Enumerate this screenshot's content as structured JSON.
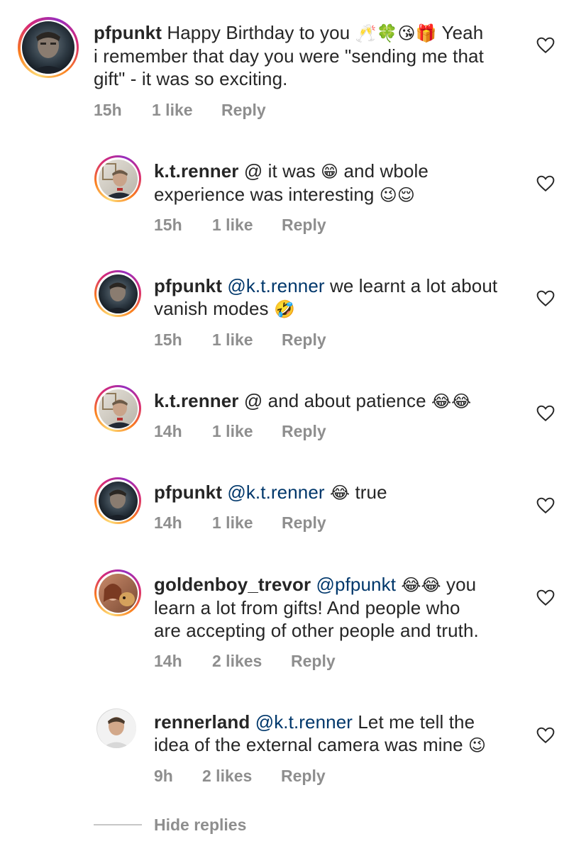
{
  "comments": [
    {
      "username": "pfpunkt",
      "mention": "",
      "text_before": "Happy Birthday to you",
      "emoji_a": "🥂🍀😘🎁",
      "text_after_line1": " Yeah",
      "line2": "i remember that day you were \"sending me that",
      "line3": "gift\" - it was so exciting.",
      "time": "15h",
      "likes": "1 like",
      "reply": "Reply"
    },
    {
      "username": "k.t.renner",
      "mention": "@",
      "line1_text": " it was ",
      "emoji_a": "😁",
      "line1_after": " and wbole",
      "line2": "experience was interesting ",
      "emoji_b": "😉😌",
      "time": "15h",
      "likes": "1 like",
      "reply": "Reply"
    },
    {
      "username": "pfpunkt",
      "mention": "@k.t.renner",
      "line1_text": " we learnt a lot about",
      "line2": "vanish modes ",
      "emoji_b": "🤣",
      "time": "15h",
      "likes": "1 like",
      "reply": "Reply"
    },
    {
      "username": "k.t.renner",
      "mention": "@",
      "line1_text": " and about patience ",
      "emoji_a": "😂😂",
      "time": "14h",
      "likes": "1 like",
      "reply": "Reply"
    },
    {
      "username": "pfpunkt",
      "mention": "@k.t.renner",
      "emoji_a": "😂",
      "line1_after": " true",
      "time": "14h",
      "likes": "1 like",
      "reply": "Reply"
    },
    {
      "username": "goldenboy_trevor",
      "mention": "@pfpunkt",
      "emoji_a": "😂😂",
      "line1_after": " you",
      "line2": "learn a lot from gifts! And people who",
      "line3": "are accepting of other people and truth.",
      "time": "14h",
      "likes": "2 likes",
      "reply": "Reply"
    },
    {
      "username": "rennerland",
      "mention": "@k.t.renner",
      "line1_text": " Let me tell the",
      "line2": "idea of the external camera was mine ",
      "emoji_b": "😉",
      "time": "9h",
      "likes": "2 likes",
      "reply": "Reply"
    }
  ],
  "hide_replies": "Hide replies",
  "colors": {
    "mention": "#00376b",
    "meta": "#8e8e8e",
    "text": "#262626"
  },
  "icons": {
    "like": "heart-outline-icon"
  }
}
